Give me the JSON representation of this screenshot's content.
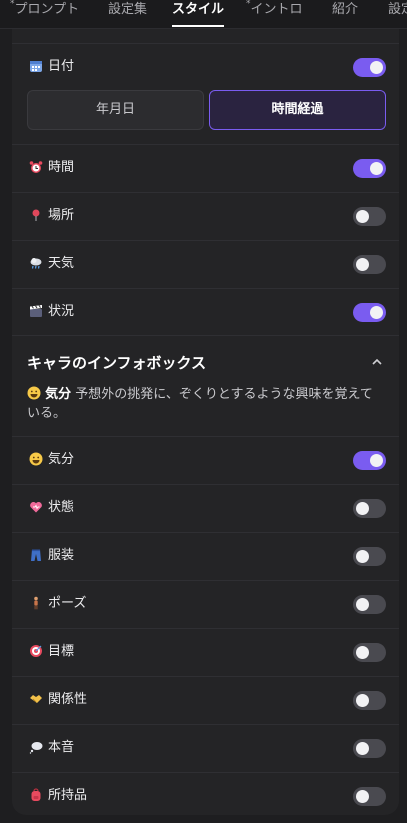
{
  "tabs": [
    {
      "label": "プロンプト",
      "marked": true
    },
    {
      "label": "設定集",
      "marked": false
    },
    {
      "label": "スタイル",
      "marked": false,
      "active": true
    },
    {
      "label": "イントロ",
      "marked": true
    },
    {
      "label": "紹介",
      "marked": false
    },
    {
      "label": "設定",
      "marked": false
    }
  ],
  "date": {
    "label": "日付",
    "enabled": true,
    "icon": "calendar-icon",
    "options": [
      "年月日",
      "時間経過"
    ],
    "selected": "時間経過"
  },
  "settings": [
    {
      "label": "時間",
      "icon": "alarm-clock-icon",
      "enabled": true
    },
    {
      "label": "場所",
      "icon": "pushpin-icon",
      "enabled": false
    },
    {
      "label": "天気",
      "icon": "cloud-rain-icon",
      "enabled": false
    },
    {
      "label": "状況",
      "icon": "clapperboard-icon",
      "enabled": true
    }
  ],
  "infobox": {
    "title": "キャラのインフォボックス",
    "expanded": true,
    "mood_label": "気分",
    "mood_text": "予想外の挑発に、ぞくりとするような興味を覚えている。",
    "items": [
      {
        "label": "気分",
        "icon": "grinning-face-icon",
        "enabled": true
      },
      {
        "label": "状態",
        "icon": "heart-icon",
        "enabled": false
      },
      {
        "label": "服装",
        "icon": "jeans-icon",
        "enabled": false
      },
      {
        "label": "ポーズ",
        "icon": "standing-person-icon",
        "enabled": false
      },
      {
        "label": "目標",
        "icon": "target-icon",
        "enabled": false
      },
      {
        "label": "関係性",
        "icon": "handshake-icon",
        "enabled": false
      },
      {
        "label": "本音",
        "icon": "speech-bubble-icon",
        "enabled": false
      },
      {
        "label": "所持品",
        "icon": "backpack-icon",
        "enabled": false
      }
    ]
  },
  "colors": {
    "accent": "#7a5cf0",
    "toggle_off": "#4a4a50",
    "panel": "#242426",
    "background": "#1e1e20"
  }
}
